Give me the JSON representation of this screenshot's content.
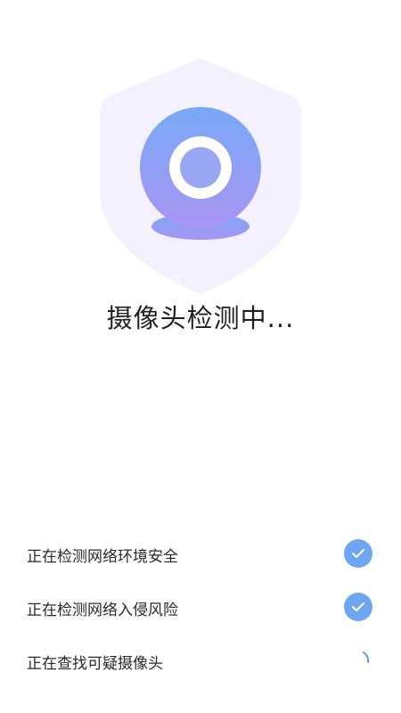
{
  "scan": {
    "title": "摄像头检测中..."
  },
  "checks": [
    {
      "label": "正在检测网络环境安全",
      "status": "done",
      "icon": "check-circle-icon"
    },
    {
      "label": "正在检测网络入侵风险",
      "status": "done",
      "icon": "check-circle-icon"
    },
    {
      "label": "正在查找可疑摄像头",
      "status": "loading",
      "icon": "spinner-icon"
    }
  ],
  "colors": {
    "shield": "#f3f1fd",
    "camera_top": "#78a9f6",
    "camera_bottom": "#a995f3",
    "check": "#6fa6f3"
  }
}
